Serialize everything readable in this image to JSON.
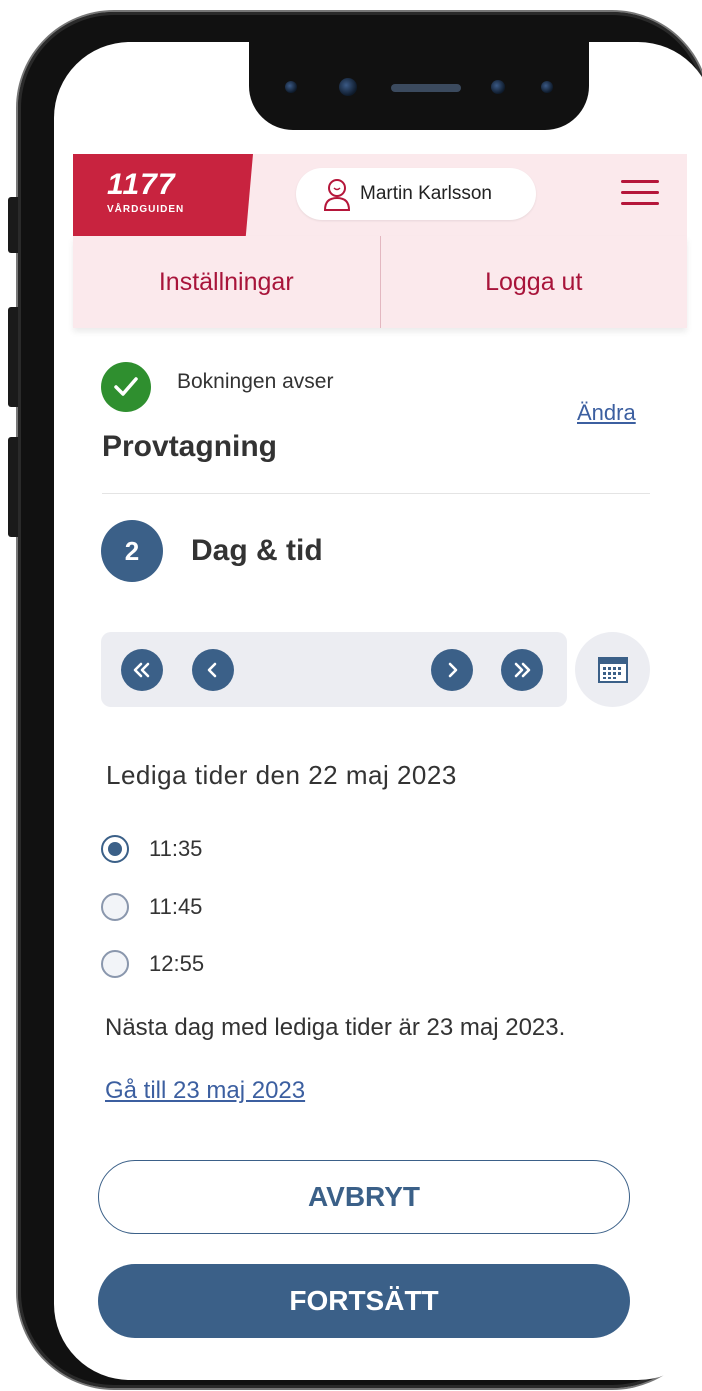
{
  "header": {
    "logo_number": "1177",
    "logo_subtitle": "VÅRDGUIDEN",
    "user_name": "Martin Karlsson"
  },
  "subnav": {
    "settings": "Inställningar",
    "logout": "Logga ut"
  },
  "booking": {
    "label": "Bokningen avser",
    "type": "Provtagning",
    "change_link": "Ändra"
  },
  "step": {
    "number": "2",
    "title": "Dag & tid"
  },
  "date_nav": {
    "first_icon": "double-chevron-left",
    "prev_icon": "chevron-left",
    "next_icon": "chevron-right",
    "last_icon": "double-chevron-right",
    "calendar_icon": "calendar"
  },
  "slots": {
    "heading": "Lediga tider den 22 maj 2023",
    "times": [
      {
        "time": "11:35",
        "selected": true
      },
      {
        "time": "11:45",
        "selected": false
      },
      {
        "time": "12:55",
        "selected": false
      }
    ]
  },
  "next_day": {
    "text": "Nästa dag med lediga tider är 23 maj 2023.",
    "link": "Gå till 23 maj 2023"
  },
  "actions": {
    "cancel": "AVBRYT",
    "continue": "FORTSÄTT"
  },
  "colors": {
    "brand_red": "#c8233f",
    "primary_blue": "#3b6088",
    "header_bg": "#fbe9ec",
    "success_green": "#2f8f2f",
    "link_blue": "#3c5fa0"
  }
}
